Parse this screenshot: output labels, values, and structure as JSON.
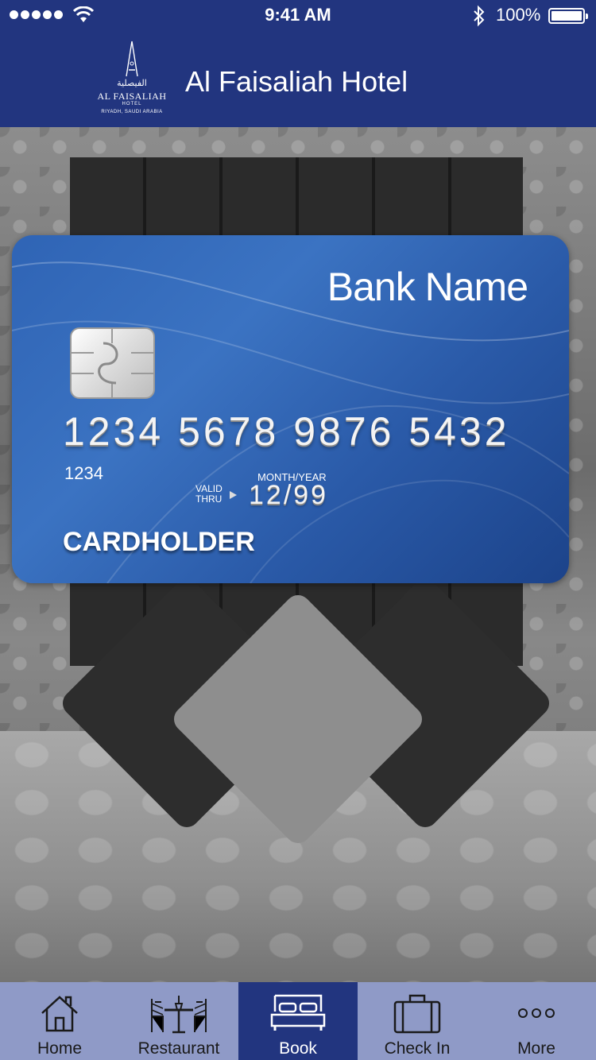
{
  "status_bar": {
    "time": "9:41 AM",
    "battery_percent": "100%",
    "signal_icon": "signal-dots-icon",
    "wifi_icon": "wifi-icon",
    "bluetooth_icon": "bluetooth-icon",
    "battery_level": 1.0
  },
  "header": {
    "title": "Al Faisaliah Hotel",
    "logo": {
      "arabic": "الفيصلية",
      "name": "AL FAISALIAH",
      "sub": "HOTEL",
      "city": "RIYADH, SAUDI ARABIA"
    },
    "background_color": "#22357f"
  },
  "card": {
    "bank_name": "Bank Name",
    "number": "1234 5678 9876 5432",
    "small_number": "1234",
    "valid_thru_line1": "VALID",
    "valid_thru_line2": "THRU",
    "month_year_label": "MONTH/YEAR",
    "expiry": "12/99",
    "cardholder": "CARDHOLDER"
  },
  "tabbar": {
    "background_color": "#8f9ac7",
    "active_color": "#22357f",
    "items": [
      {
        "label": "Home",
        "icon": "home-icon",
        "active": false
      },
      {
        "label": "Restaurant",
        "icon": "restaurant-icon",
        "active": false
      },
      {
        "label": "Book",
        "icon": "bed-icon",
        "active": true
      },
      {
        "label": "Check In",
        "icon": "suitcase-icon",
        "active": false
      },
      {
        "label": "More",
        "icon": "more-dots-icon",
        "active": false
      }
    ]
  }
}
